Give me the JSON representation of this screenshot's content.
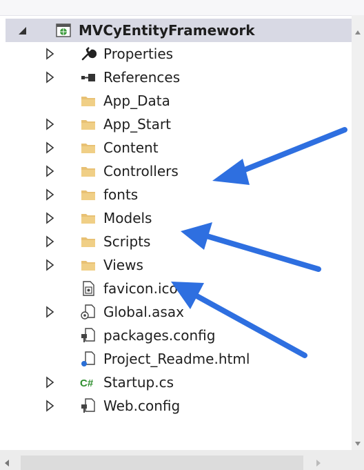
{
  "solution_explorer": {
    "project": {
      "label": "MVCyEntityFramework",
      "expanded": true,
      "icon": "web-project-icon"
    },
    "items": [
      {
        "label": "Properties",
        "icon": "wrench-icon",
        "expandable": true
      },
      {
        "label": "References",
        "icon": "references-icon",
        "expandable": true
      },
      {
        "label": "App_Data",
        "icon": "folder-icon",
        "expandable": false
      },
      {
        "label": "App_Start",
        "icon": "folder-icon",
        "expandable": true
      },
      {
        "label": "Content",
        "icon": "folder-icon",
        "expandable": true
      },
      {
        "label": "Controllers",
        "icon": "folder-icon",
        "expandable": true
      },
      {
        "label": "fonts",
        "icon": "folder-icon",
        "expandable": true
      },
      {
        "label": "Models",
        "icon": "folder-icon",
        "expandable": true
      },
      {
        "label": "Scripts",
        "icon": "folder-icon",
        "expandable": true
      },
      {
        "label": "Views",
        "icon": "folder-icon",
        "expandable": true
      },
      {
        "label": "favicon.ico",
        "icon": "image-file-icon",
        "expandable": false
      },
      {
        "label": "Global.asax",
        "icon": "asax-file-icon",
        "expandable": true
      },
      {
        "label": "packages.config",
        "icon": "config-file-icon",
        "expandable": false
      },
      {
        "label": "Project_Readme.html",
        "icon": "html-file-icon",
        "expandable": false
      },
      {
        "label": "Startup.cs",
        "icon": "csharp-file-icon",
        "expandable": true
      },
      {
        "label": "Web.config",
        "icon": "config-file-icon",
        "expandable": true
      }
    ]
  },
  "annotations": {
    "arrow_color": "#2e6fe0",
    "pointing_at": [
      "Controllers",
      "Models",
      "Views"
    ]
  },
  "colors": {
    "selection_background": "#d8d9e4",
    "folder": "#e8c174",
    "text": "#1e1e1e"
  }
}
